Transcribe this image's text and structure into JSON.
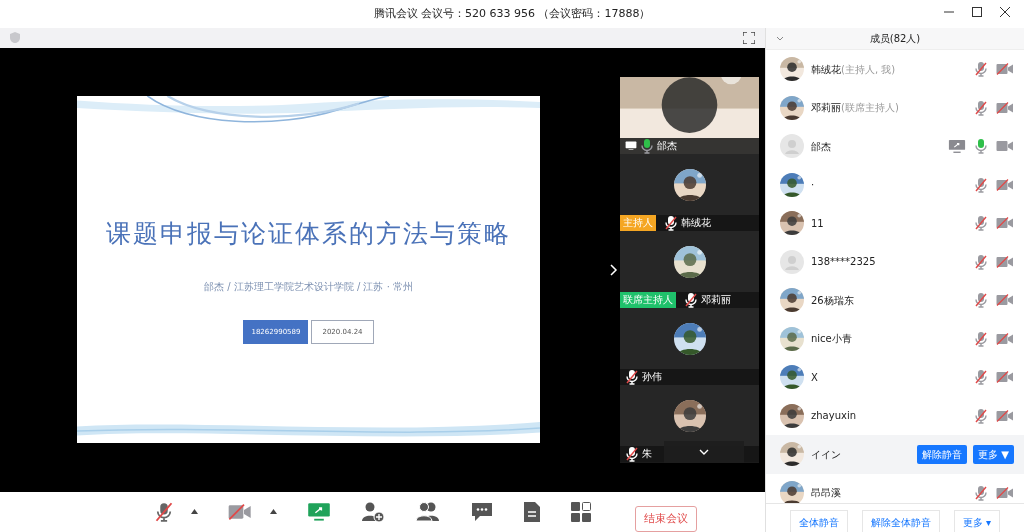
{
  "window": {
    "title": "腾讯会议 会议号：520 633 956 （会议密码：17888）"
  },
  "slide": {
    "title": "课题申报与论证体系的方法与策略",
    "subtitle": "邰杰 / 江苏理工学院艺术设计学院 / 江苏 · 常州",
    "phone": "18262990589",
    "date": "2020.04.24"
  },
  "video_tiles": [
    {
      "kind": "video",
      "name": "邰杰",
      "mic_muted": false,
      "sharing": true
    },
    {
      "kind": "avatar",
      "name": "韩绒花",
      "badge": "主持人",
      "color": "#f5a623",
      "mic_muted": true,
      "sharing": false
    },
    {
      "kind": "avatar",
      "name": "邓莉丽",
      "badge": "联席主持人",
      "color": "#1fc16b",
      "mic_muted": true,
      "sharing": false
    },
    {
      "kind": "avatar",
      "name": "孙伟",
      "mic_muted": true,
      "sharing": false
    },
    {
      "kind": "avatar",
      "name": "朱",
      "mic_muted": true,
      "sharing": false
    }
  ],
  "toolbar": {
    "mic_muted": true,
    "camera_off": true,
    "sharing": true,
    "end_button": "结束会议"
  },
  "members": {
    "header": "成员(82人)",
    "items": [
      {
        "name": "韩绒花",
        "role": "(主持人, 我)",
        "has_photo": true,
        "mic_muted": true,
        "camera": false,
        "sharing": false,
        "hovered": false
      },
      {
        "name": "邓莉丽",
        "role": "(联席主持人)",
        "has_photo": true,
        "mic_muted": true,
        "camera": false,
        "sharing": false,
        "hovered": false
      },
      {
        "name": "邰杰",
        "has_photo": false,
        "mic_muted": false,
        "camera": true,
        "sharing": true,
        "hovered": false
      },
      {
        "name": "·",
        "has_photo": true,
        "mic_muted": true,
        "camera": false,
        "sharing": false,
        "hovered": false
      },
      {
        "name": "11",
        "has_photo": true,
        "mic_muted": true,
        "camera": false,
        "sharing": false,
        "hovered": false
      },
      {
        "name": "138****2325",
        "has_photo": false,
        "mic_muted": true,
        "camera": false,
        "sharing": false,
        "hovered": false
      },
      {
        "name": "26杨瑞东",
        "has_photo": true,
        "mic_muted": true,
        "camera": false,
        "sharing": false,
        "hovered": false
      },
      {
        "name": "nice小青",
        "has_photo": true,
        "mic_muted": true,
        "camera": false,
        "sharing": false,
        "hovered": false
      },
      {
        "name": "X",
        "has_photo": true,
        "mic_muted": true,
        "camera": false,
        "sharing": false,
        "hovered": false
      },
      {
        "name": "zhayuxin",
        "has_photo": true,
        "mic_muted": true,
        "camera": false,
        "sharing": false,
        "hovered": false
      },
      {
        "name": "イイン",
        "has_photo": true,
        "hovered": true,
        "actions": [
          "解除静音",
          "更多 ▼"
        ]
      },
      {
        "name": "昂昂溪",
        "has_photo": true,
        "mic_muted": true,
        "camera": false,
        "sharing": false,
        "hovered": false
      }
    ],
    "footer_buttons": [
      "全体静音",
      "解除全体静音",
      "更多 ▾"
    ]
  }
}
